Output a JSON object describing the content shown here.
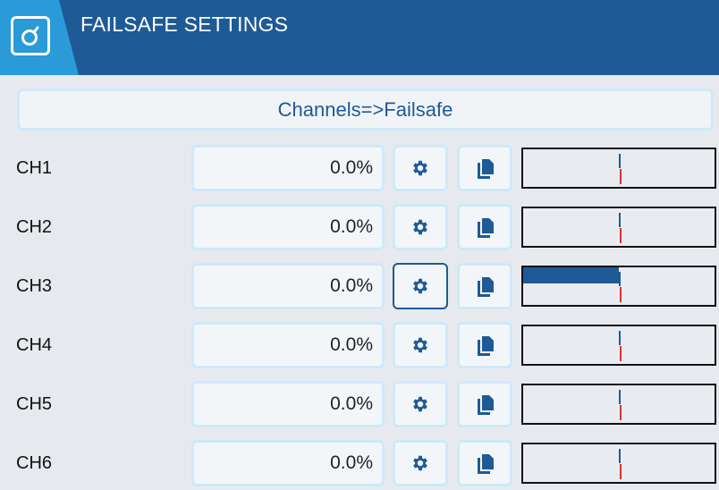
{
  "header": {
    "title": "FAILSAFE SETTINGS",
    "icon": "failsafe-icon"
  },
  "banner": {
    "label": "Channels=>Failsafe"
  },
  "channels": [
    {
      "label": "CH1",
      "value": "0.0%",
      "output_fraction": 0.0,
      "focused": false
    },
    {
      "label": "CH2",
      "value": "0.0%",
      "output_fraction": 0.0,
      "focused": false
    },
    {
      "label": "CH3",
      "value": "0.0%",
      "output_fraction": 0.5,
      "focused": true
    },
    {
      "label": "CH4",
      "value": "0.0%",
      "output_fraction": 0.0,
      "focused": false
    },
    {
      "label": "CH5",
      "value": "0.0%",
      "output_fraction": 0.0,
      "focused": false
    },
    {
      "label": "CH6",
      "value": "0.0%",
      "output_fraction": 0.0,
      "focused": false
    }
  ],
  "icons": {
    "settings": "gear-icon",
    "copy": "copy-icon"
  },
  "colors": {
    "header": "#1e5a96",
    "header_tab": "#2b9ad8",
    "accent": "#1e5a96",
    "marker_red": "#e03030",
    "border_light": "#cfe9f7"
  }
}
